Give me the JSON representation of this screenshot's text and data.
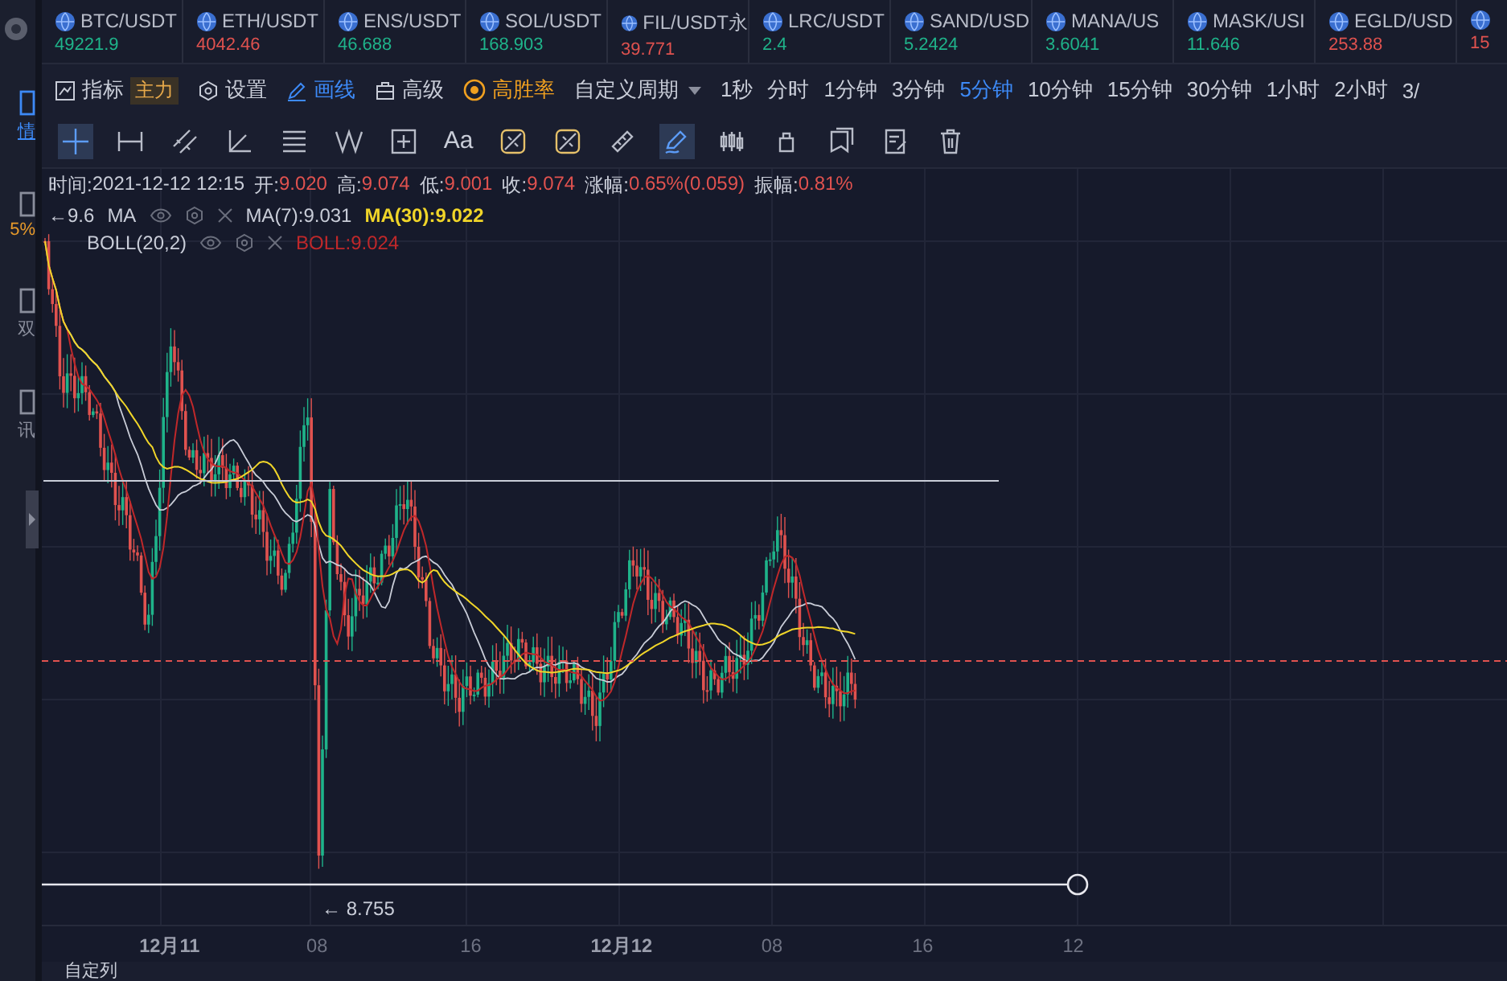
{
  "tickers": [
    {
      "symbol": "BTC/USDT",
      "price": "49221.9",
      "color": "#1fb38a"
    },
    {
      "symbol": "ETH/USDT",
      "price": "4042.46",
      "color": "#e0524f"
    },
    {
      "symbol": "ENS/USDT",
      "price": "46.688",
      "color": "#1fb38a"
    },
    {
      "symbol": "SOL/USDT",
      "price": "168.903",
      "color": "#1fb38a"
    },
    {
      "symbol": "FIL/USDT永",
      "price": "39.771",
      "color": "#e0524f"
    },
    {
      "symbol": "LRC/USDT",
      "price": "2.4",
      "color": "#1fb38a"
    },
    {
      "symbol": "SAND/USD",
      "price": "5.2424",
      "color": "#1fb38a"
    },
    {
      "symbol": "MANA/US",
      "price": "3.6041",
      "color": "#1fb38a"
    },
    {
      "symbol": "MASK/USI",
      "price": "11.646",
      "color": "#1fb38a"
    },
    {
      "symbol": "EGLD/USD",
      "price": "253.88",
      "color": "#e0524f"
    },
    {
      "price": "15",
      "color": "#e0524f"
    }
  ],
  "sidebar": [
    {
      "kind": "nav",
      "label": "情",
      "selected": true
    },
    {
      "kind": "percent",
      "label": "5%",
      "selected": false
    },
    {
      "kind": "nav",
      "label": "双",
      "selected": false
    },
    {
      "kind": "nav",
      "label": "讯",
      "selected": false
    }
  ],
  "menu": [
    {
      "kind": "indicator",
      "label": "指标",
      "badge": "主力",
      "selected": false
    },
    {
      "kind": "settings",
      "label": "设置",
      "selected": false
    },
    {
      "kind": "draw",
      "label": "画线",
      "selected": true
    },
    {
      "kind": "advanced",
      "label": "高级",
      "selected": false
    },
    {
      "kind": "premium",
      "label": "高胜率",
      "selected": false
    }
  ],
  "period_dropdown": "自定义周期",
  "periods": [
    {
      "label": "1秒",
      "selected": false
    },
    {
      "label": "分时",
      "selected": false
    },
    {
      "label": "1分钟",
      "selected": false
    },
    {
      "label": "3分钟",
      "selected": false
    },
    {
      "label": "5分钟",
      "selected": true
    },
    {
      "label": "10分钟",
      "selected": false
    },
    {
      "label": "15分钟",
      "selected": false
    },
    {
      "label": "30分钟",
      "selected": false
    },
    {
      "label": "1小时",
      "selected": false
    },
    {
      "label": "2小时",
      "selected": false
    },
    {
      "label": "3/",
      "selected": false
    }
  ],
  "drawing_tools": [
    {
      "kind": "crosshair",
      "selected": true
    },
    {
      "kind": "segment",
      "selected": false
    },
    {
      "kind": "parallel",
      "selected": false
    },
    {
      "kind": "angle",
      "selected": false
    },
    {
      "kind": "fib",
      "selected": false
    },
    {
      "kind": "wave",
      "selected": false
    },
    {
      "kind": "rect",
      "selected": false
    },
    {
      "kind": "text",
      "label": "Aa",
      "selected": false
    },
    {
      "kind": "ruler-a",
      "selected": false
    },
    {
      "kind": "ruler-b",
      "selected": false
    },
    {
      "kind": "ruler",
      "selected": false
    },
    {
      "kind": "pen",
      "selected": true
    },
    {
      "kind": "candles",
      "selected": false
    },
    {
      "kind": "lock",
      "selected": false
    },
    {
      "kind": "copy",
      "selected": false
    },
    {
      "kind": "edit",
      "selected": false
    },
    {
      "kind": "trash",
      "selected": false
    }
  ],
  "ohlc": [
    {
      "kind": "time",
      "label": "时间:",
      "value": "2021-12-12 12:15"
    },
    {
      "kind": "price",
      "label": "开:",
      "value": "9.020"
    },
    {
      "kind": "price",
      "label": "高:",
      "value": "9.074"
    },
    {
      "kind": "price",
      "label": "低:",
      "value": "9.001"
    },
    {
      "kind": "price",
      "label": "收:",
      "value": "9.074"
    },
    {
      "kind": "price",
      "label": "涨幅:",
      "value": "0.65%(0.059)"
    },
    {
      "kind": "price",
      "label": "振幅:",
      "value": "0.81%"
    }
  ],
  "indicators": [
    {
      "name": "MA",
      "values": [
        {
          "kind": "ma7",
          "text": "MA(7):9.031"
        },
        {
          "kind": "ma30",
          "text": "MA(30):9.022"
        }
      ]
    },
    {
      "name": "BOLL(20,2)",
      "values": [
        {
          "kind": "boll",
          "text": "BOLL:9.024"
        }
      ]
    }
  ],
  "price_markers": {
    "high": "←9.6",
    "low": "← 8.755"
  },
  "x_axis": [
    {
      "label": "12月11",
      "bold": true
    },
    {
      "label": "08",
      "bold": false
    },
    {
      "label": "16",
      "bold": false
    },
    {
      "label": "12月12",
      "bold": true
    },
    {
      "label": "08",
      "bold": false
    },
    {
      "label": "16",
      "bold": false
    },
    {
      "label": "12",
      "bold": false
    }
  ],
  "bottom_tab": "自定列"
}
